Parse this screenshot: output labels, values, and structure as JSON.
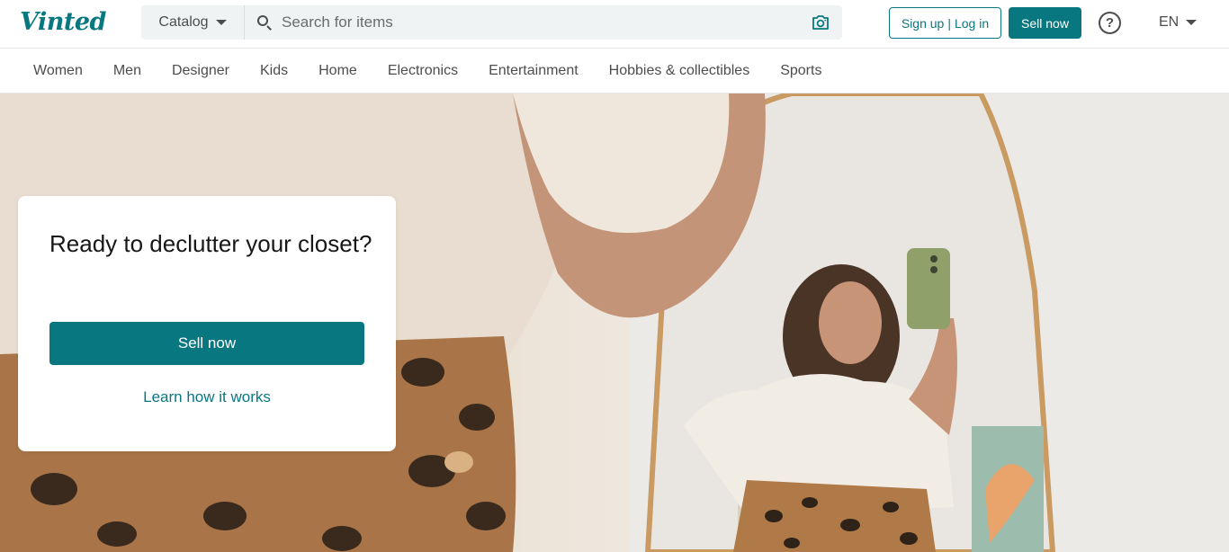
{
  "header": {
    "logo": "Vinted",
    "catalog_label": "Catalog",
    "search_placeholder": "Search for items",
    "signup_label": "Sign up",
    "separator": "|",
    "login_label": "Log in",
    "sell_label": "Sell now",
    "help_glyph": "?",
    "language": "EN",
    "icons": [
      "chevron-down-icon",
      "search-icon",
      "camera-icon",
      "help-icon"
    ]
  },
  "nav": {
    "items": [
      "Women",
      "Men",
      "Designer",
      "Kids",
      "Home",
      "Electronics",
      "Entertainment",
      "Hobbies & collectibles",
      "Sports"
    ]
  },
  "hero": {
    "title": "Ready to declutter your closet?",
    "sell_button": "Sell now",
    "learn_link": "Learn how it works"
  },
  "colors": {
    "brand": "#09777f",
    "text": "#171717",
    "muted": "#4d4d4d"
  }
}
